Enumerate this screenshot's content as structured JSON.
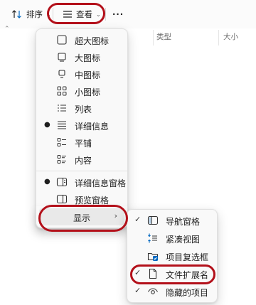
{
  "toolbar": {
    "sort_label": "排序",
    "view_label": "查看",
    "more_label": "..."
  },
  "columns": {
    "type": "类型",
    "size": "大小"
  },
  "view_menu": {
    "items": [
      {
        "label": "超大图标",
        "icon": "extra-large-icons-icon",
        "selected": false
      },
      {
        "label": "大图标",
        "icon": "large-icons-icon",
        "selected": false
      },
      {
        "label": "中图标",
        "icon": "medium-icons-icon",
        "selected": false
      },
      {
        "label": "小图标",
        "icon": "small-icons-icon",
        "selected": false
      },
      {
        "label": "列表",
        "icon": "list-icon",
        "selected": false
      },
      {
        "label": "详细信息",
        "icon": "details-icon",
        "selected": true
      },
      {
        "label": "平铺",
        "icon": "tiles-icon",
        "selected": false
      },
      {
        "label": "内容",
        "icon": "content-icon",
        "selected": false
      },
      {
        "label": "详细信息窗格",
        "icon": "details-pane-icon",
        "selected": true
      },
      {
        "label": "预览窗格",
        "icon": "preview-pane-icon",
        "selected": false
      },
      {
        "label": "显示",
        "icon": "",
        "submenu": true
      }
    ]
  },
  "show_submenu": {
    "items": [
      {
        "label": "导航窗格",
        "icon": "navigation-pane-icon",
        "checked": true
      },
      {
        "label": "紧凑视图",
        "icon": "compact-view-icon",
        "checked": false
      },
      {
        "label": "项目复选框",
        "icon": "item-checkbox-icon",
        "checked": false
      },
      {
        "label": "文件扩展名",
        "icon": "file-extension-icon",
        "checked": true
      },
      {
        "label": "隐藏的项目",
        "icon": "hidden-items-icon",
        "checked": true
      }
    ]
  },
  "colors": {
    "annotation_ring": "#b3101a",
    "accent": "#0067c0"
  }
}
